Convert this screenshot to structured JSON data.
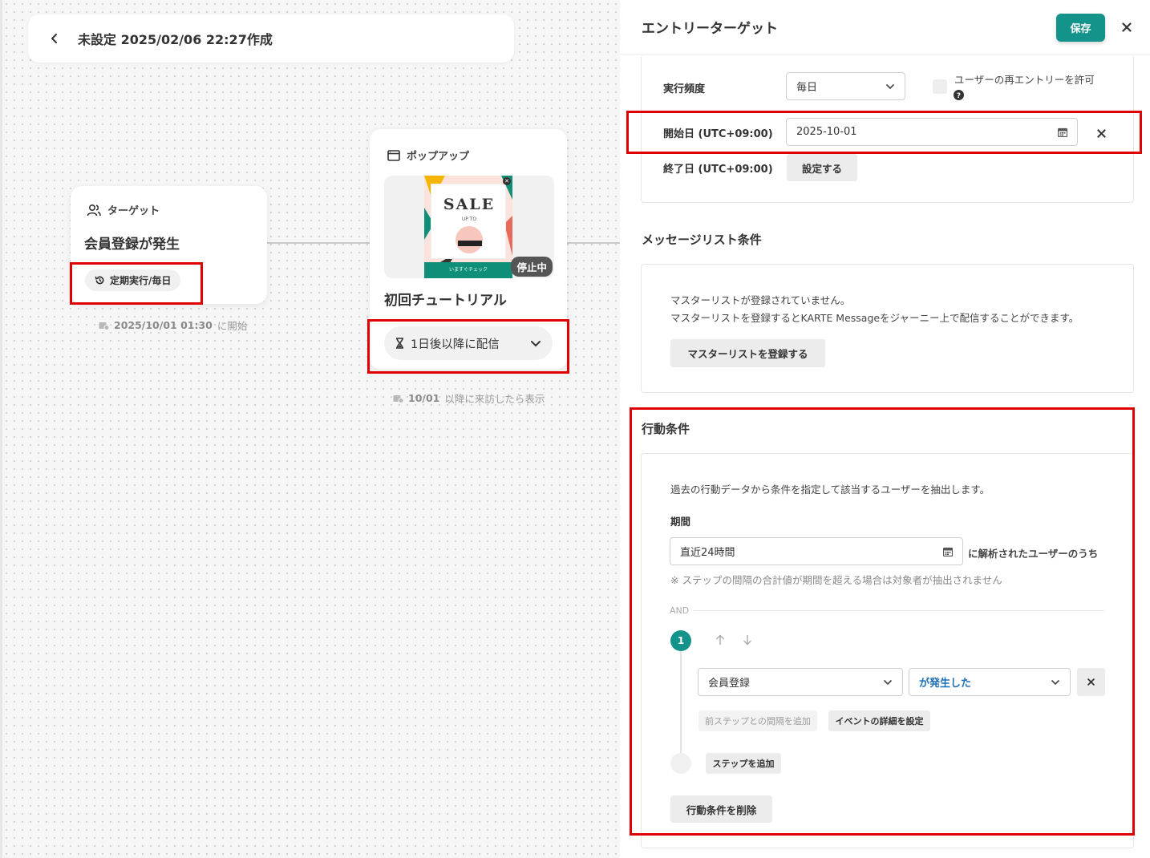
{
  "canvas": {
    "title": "未設定 2025/02/06 22:27作成",
    "target_node": {
      "header": "ターゲット",
      "title": "会員登録が発生",
      "chip": "定期実行/毎日",
      "note_date": "2025/10/01 01:30",
      "note_suffix": "に開始"
    },
    "popup_node": {
      "header": "ポップアップ",
      "status": "停止中",
      "title": "初回チュートリアル",
      "delivery": "1日後以降に配信",
      "note_date": "10/01",
      "note_suffix": "以降に来訪したら表示",
      "image": {
        "headline": "SALE",
        "sub": "UP TO",
        "footer": "いますぐチェック"
      }
    }
  },
  "panel": {
    "title": "エントリーターゲット",
    "save_label": "保存",
    "frequency_label": "実行頻度",
    "frequency_value": "毎日",
    "reentry_label": "ユーザーの再エントリーを許可",
    "start_label": "開始日 (UTC+09:00)",
    "start_value": "2025-10-01",
    "end_label": "終了日 (UTC+09:00)",
    "end_button": "設定する",
    "message_section": {
      "title": "メッセージリスト条件",
      "line1": "マスターリストが登録されていません。",
      "line2": "マスターリストを登録するとKARTE Messageをジャーニー上で配信することができます。",
      "button": "マスターリストを登録する"
    },
    "behavior_section": {
      "title": "行動条件",
      "description": "過去の行動データから条件を指定して該当するユーザーを抽出します。",
      "period_label": "期間",
      "period_value": "直近24時間",
      "period_suffix": "に解析されたユーザーのうち",
      "note": "※ ステップの間隔の合計値が期間を超える場合は対象者が抽出されません",
      "and_label": "AND",
      "step_number": "1",
      "event_value": "会員登録",
      "condition_value": "が発生した",
      "add_interval": "前ステップとの間隔を追加",
      "event_detail": "イベントの詳細を設定",
      "add_step": "ステップを追加",
      "delete_button": "行動条件を削除"
    }
  },
  "colors": {
    "accent": "#14938a",
    "highlight": "#e00000",
    "link": "#1a6fb5"
  }
}
